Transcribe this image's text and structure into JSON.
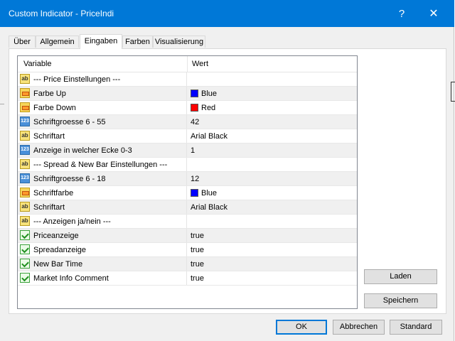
{
  "window": {
    "title": "Custom Indicator - PriceIndi",
    "help_glyph": "?",
    "close_glyph": "✕",
    "accent": "#0078d7"
  },
  "tabs": [
    {
      "label": "Über"
    },
    {
      "label": "Allgemein"
    },
    {
      "label": "Eingaben",
      "active": true
    },
    {
      "label": "Farben"
    },
    {
      "label": "Visualisierung"
    }
  ],
  "grid": {
    "headers": {
      "variable": "Variable",
      "value": "Wert"
    },
    "rows": [
      {
        "icon": "string-icon",
        "variable": "--- Price Einstellungen ---",
        "value": ""
      },
      {
        "icon": "color-icon",
        "variable": "Farbe Up",
        "value": "Blue",
        "swatch": "#0000ff"
      },
      {
        "icon": "color-icon",
        "variable": "Farbe Down",
        "value": "Red",
        "swatch": "#ff0000"
      },
      {
        "icon": "number-icon",
        "variable": "Schriftgroesse 6 - 55",
        "value": "42"
      },
      {
        "icon": "string-icon",
        "variable": "Schriftart",
        "value": "Arial Black"
      },
      {
        "icon": "number-icon",
        "variable": "Anzeige in welcher Ecke 0-3",
        "value": "1"
      },
      {
        "icon": "string-icon",
        "variable": "--- Spread & New Bar Einstellungen ---",
        "value": ""
      },
      {
        "icon": "number-icon",
        "variable": "Schriftgroesse 6 - 18",
        "value": "12"
      },
      {
        "icon": "color-icon",
        "variable": "Schriftfarbe",
        "value": "Blue",
        "swatch": "#0000ff"
      },
      {
        "icon": "string-icon",
        "variable": "Schriftart",
        "value": "Arial Black"
      },
      {
        "icon": "string-icon",
        "variable": "--- Anzeigen ja/nein ---",
        "value": ""
      },
      {
        "icon": "bool-icon",
        "variable": "Priceanzeige",
        "value": "true"
      },
      {
        "icon": "bool-icon",
        "variable": "Spreadanzeige",
        "value": "true"
      },
      {
        "icon": "bool-icon",
        "variable": "New Bar Time",
        "value": "true"
      },
      {
        "icon": "bool-icon",
        "variable": "Market Info Comment",
        "value": "true"
      }
    ]
  },
  "side_buttons": {
    "load": "Laden",
    "save": "Speichern"
  },
  "footer_buttons": {
    "ok": "OK",
    "cancel": "Abbrechen",
    "default": "Standard"
  },
  "icon_text": {
    "string": "ab",
    "number": "123"
  }
}
